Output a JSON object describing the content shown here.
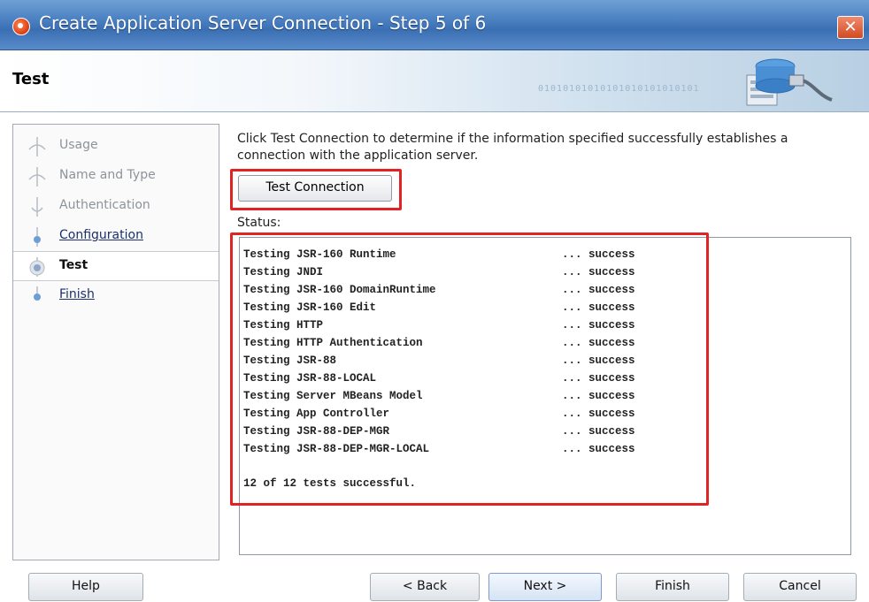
{
  "window": {
    "title": "Create Application Server Connection - Step 5 of 6",
    "close_glyph": "✕"
  },
  "header": {
    "title": "Test",
    "binary_decor": "01010101010101010101010101"
  },
  "steps": [
    {
      "label": "Usage",
      "state": "done"
    },
    {
      "label": "Name and Type",
      "state": "done"
    },
    {
      "label": "Authentication",
      "state": "done"
    },
    {
      "label": "Configuration",
      "state": "link"
    },
    {
      "label": "Test",
      "state": "current"
    },
    {
      "label": "Finish",
      "state": "link"
    }
  ],
  "main": {
    "instruction": "Click Test Connection to determine if the information specified successfully establishes a connection with the application server.",
    "test_button_label": "Test Connection",
    "status_label": "Status:",
    "log": [
      {
        "name": "Testing JSR-160 Runtime",
        "result": "... success"
      },
      {
        "name": "Testing JNDI",
        "result": "... success"
      },
      {
        "name": "Testing JSR-160 DomainRuntime",
        "result": "... success"
      },
      {
        "name": "Testing JSR-160 Edit",
        "result": "... success"
      },
      {
        "name": "Testing HTTP",
        "result": "... success"
      },
      {
        "name": "Testing HTTP Authentication",
        "result": "... success"
      },
      {
        "name": "Testing JSR-88",
        "result": "... success"
      },
      {
        "name": "Testing JSR-88-LOCAL",
        "result": "... success"
      },
      {
        "name": "Testing Server MBeans Model",
        "result": "... success"
      },
      {
        "name": "Testing App Controller",
        "result": "... success"
      },
      {
        "name": "Testing JSR-88-DEP-MGR",
        "result": "... success"
      },
      {
        "name": "Testing JSR-88-DEP-MGR-LOCAL",
        "result": "... success"
      }
    ],
    "summary": "12 of 12 tests successful."
  },
  "footer": {
    "help_label": "Help",
    "back_label": "< Back",
    "next_label": "Next >",
    "finish_label": "Finish",
    "cancel_label": "Cancel"
  },
  "colors": {
    "highlight": "#e02424",
    "titlebar": "#4f84c4"
  }
}
